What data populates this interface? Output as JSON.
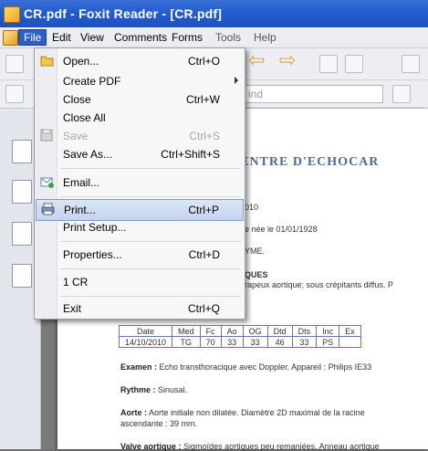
{
  "window": {
    "title": "CR.pdf - Foxit Reader - [CR.pdf]"
  },
  "menubar": {
    "items": [
      {
        "label": "File"
      },
      {
        "label": "Edit"
      },
      {
        "label": "View"
      },
      {
        "label": "Comments"
      },
      {
        "label": "Forms"
      },
      {
        "label": "Tools"
      },
      {
        "label": "Help"
      }
    ]
  },
  "toolbar": {
    "search_placeholder": "ind"
  },
  "file_menu": {
    "items": [
      {
        "label": "Open...",
        "shortcut": "Ctrl+O",
        "icon": "open-folder-icon"
      },
      {
        "label": "Create PDF",
        "shortcut": "",
        "icon": ""
      },
      {
        "label": "Close",
        "shortcut": "Ctrl+W",
        "icon": ""
      },
      {
        "label": "Close All",
        "shortcut": "",
        "icon": ""
      },
      {
        "label": "Save",
        "shortcut": "Ctrl+S",
        "icon": "save-icon",
        "disabled": true
      },
      {
        "label": "Save As...",
        "shortcut": "Ctrl+Shift+S",
        "icon": ""
      },
      {
        "label": "Email...",
        "shortcut": "",
        "icon": "email-icon"
      },
      {
        "label": "Print...",
        "shortcut": "Ctrl+P",
        "icon": "printer-icon",
        "highlighted": true
      },
      {
        "label": "Print Setup...",
        "shortcut": "",
        "icon": ""
      },
      {
        "label": "Properties...",
        "shortcut": "Ctrl+D",
        "icon": ""
      },
      {
        "label": "1 CR",
        "shortcut": "",
        "icon": ""
      },
      {
        "label": "Exit",
        "shortcut": "Ctrl+Q",
        "icon": ""
      }
    ]
  },
  "document": {
    "header": "CENTRE D'ECHOCAR",
    "line1": "010",
    "line2": "e née le 01/01/1928",
    "line3": "YME.",
    "line4_title": "QUES",
    "line4_text": "rapeux aortique; sous crépitants diffus. P",
    "table_headers": [
      "Date",
      "Med",
      "Fc",
      "Ao",
      "OG",
      "Dtd",
      "Dts",
      "Inc",
      "Ex"
    ],
    "table_values": [
      "14/10/2010",
      "TG",
      "70",
      "33",
      "33",
      "46",
      "33",
      "PS",
      ""
    ],
    "examen_label": "Examen :",
    "examen_text": "Echo transthoracique avec Doppler. Appareil : Philips IE33",
    "rythme_label": "Rythme :",
    "rythme_text": "Sinusal.",
    "aorte_label": "Aorte :",
    "aorte_text": "Aorte initiale non dilatée. Diamètre 2D maximal de la racine",
    "aorte_text2": "ascendante : 39 mm.",
    "valve_label": "Valve aortique :",
    "valve_text": "Sigmoïdes aortiques peu remaniées. Anneau aortique"
  }
}
